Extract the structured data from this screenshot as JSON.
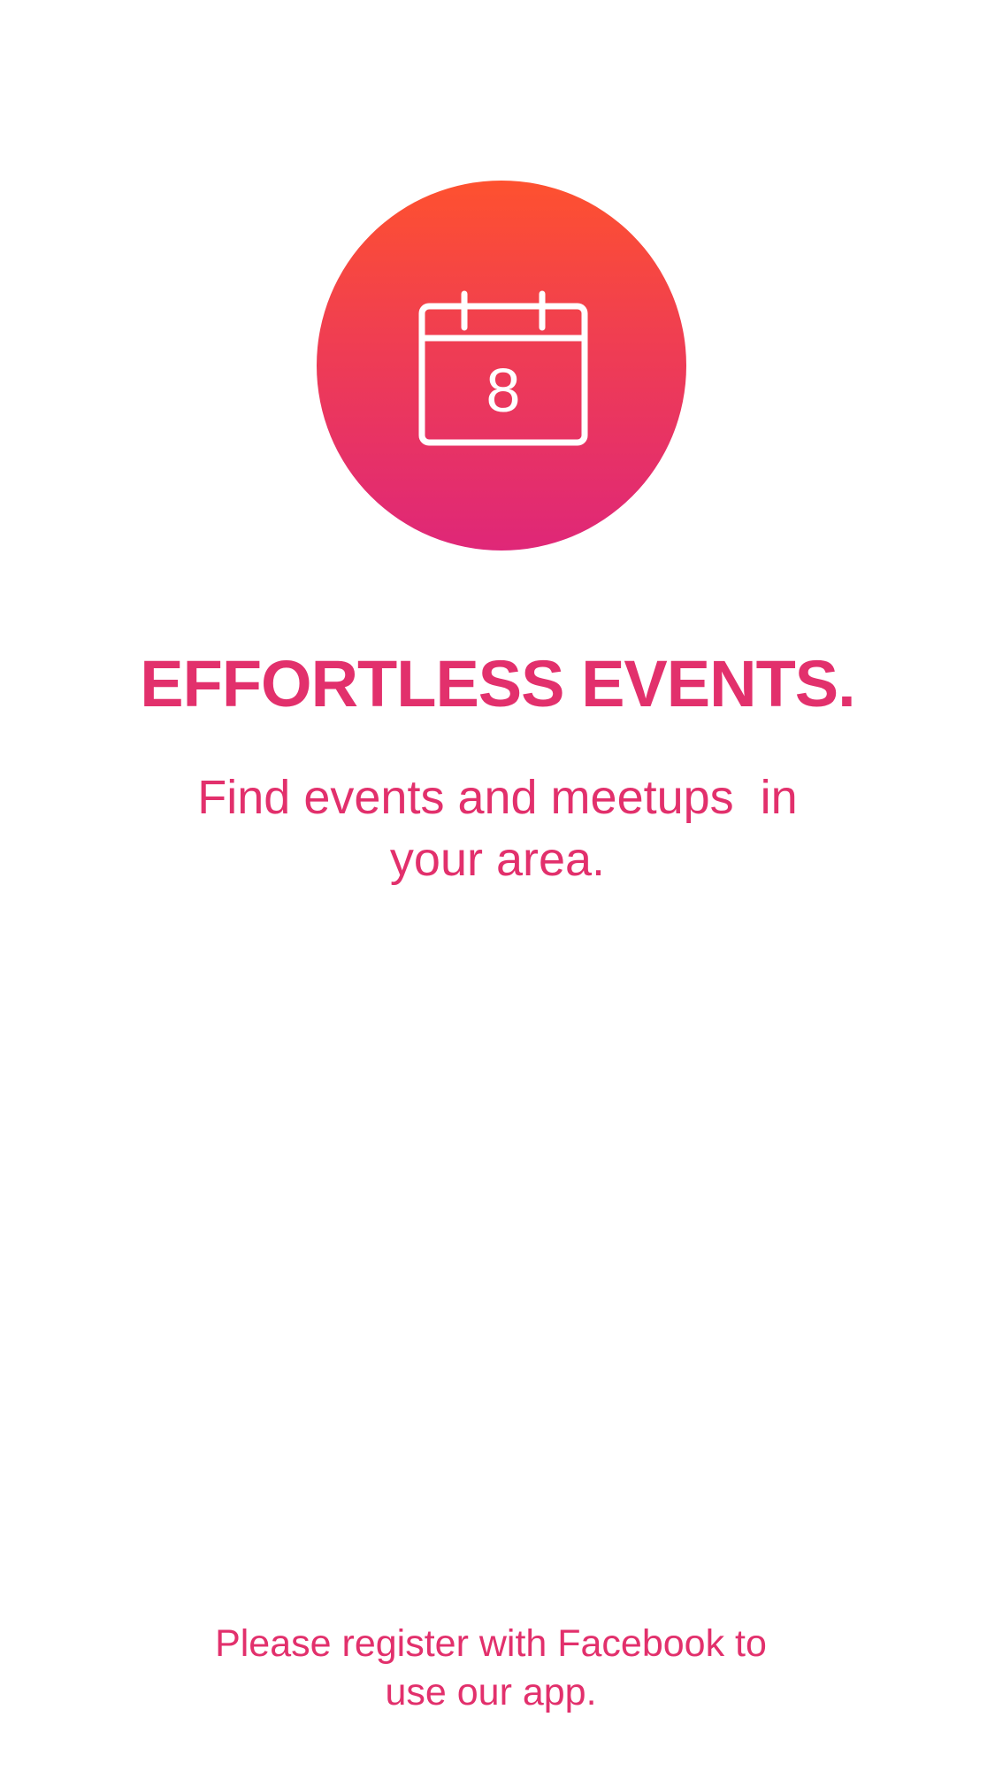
{
  "onboarding": {
    "icon": "calendar-icon",
    "calendar_day": "8",
    "headline": "EFFORTLESS EVENTS.",
    "subtitle": "Find events and meetups  in your area.",
    "register_prompt": "Please register with Facebook to use our app."
  },
  "colors": {
    "accent": "#e2306c",
    "gradient_top": "#fe512f",
    "gradient_bottom": "#df2778",
    "background": "#ffffff"
  }
}
